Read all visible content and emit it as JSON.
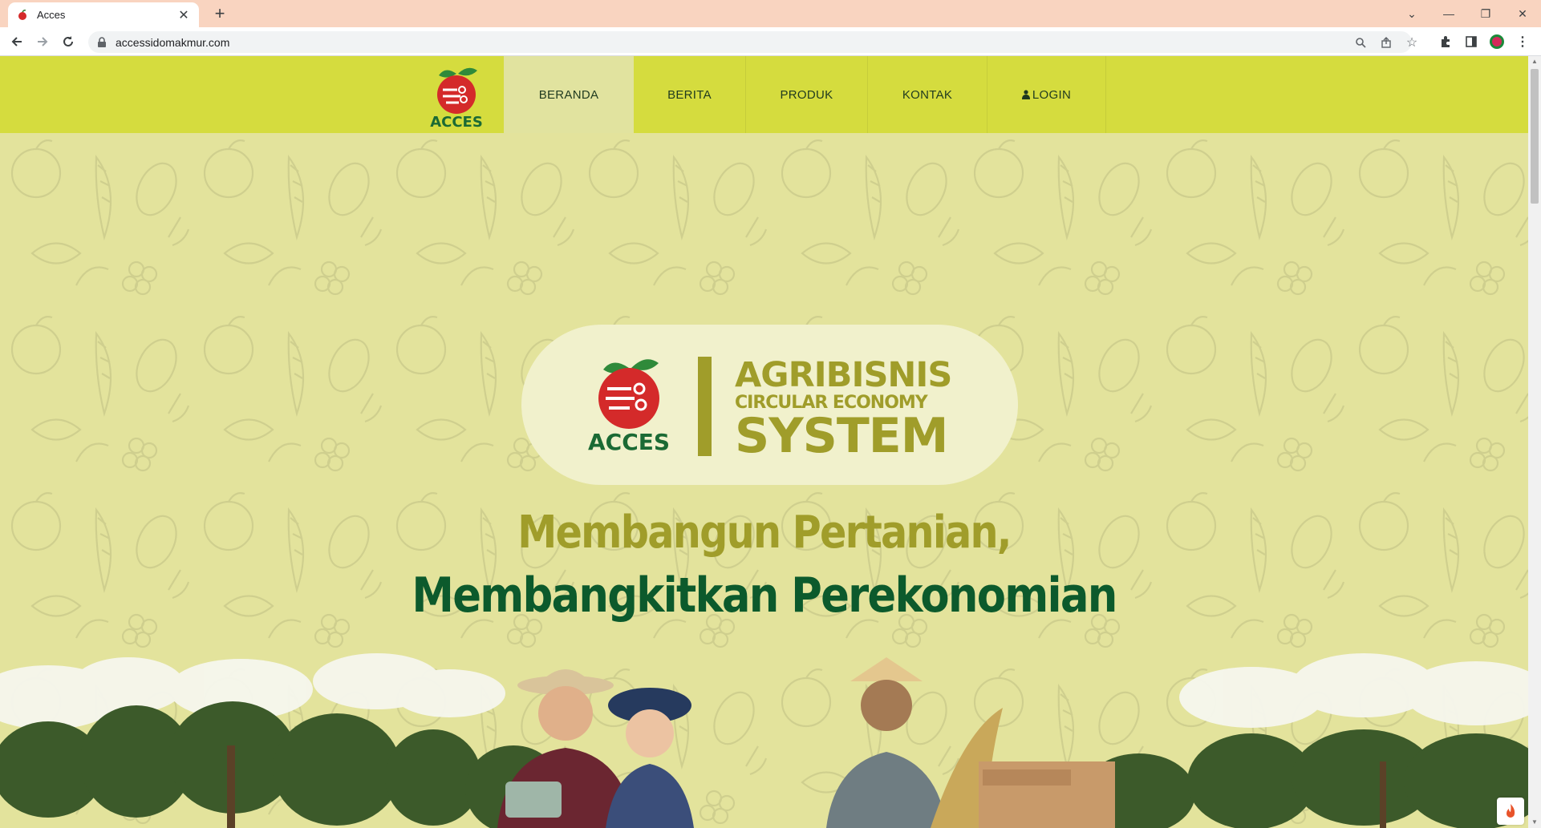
{
  "browser": {
    "tab_title": "Acces",
    "url": "accessidomakmur.com"
  },
  "nav": {
    "items": [
      {
        "label": "BERANDA",
        "active": true
      },
      {
        "label": "BERITA",
        "active": false
      },
      {
        "label": "PRODUK",
        "active": false
      },
      {
        "label": "KONTAK",
        "active": false
      },
      {
        "label": "LOGIN",
        "active": false
      }
    ],
    "login_icon": "user-icon"
  },
  "logo": {
    "text": "ACCES"
  },
  "hero": {
    "line1": "AGRIBISNIS",
    "line2": "CIRCULAR ECONOMY",
    "line3": "SYSTEM",
    "tagline1": "Membangun Pertanian,",
    "tagline2": "Membangkitkan Perekonomian"
  },
  "colors": {
    "nav_bg": "#d5dc3e",
    "page_bg": "#e3e39c",
    "olive": "#a09d2a",
    "dark_green": "#0c5a2c",
    "apple_red": "#d42a2a"
  }
}
